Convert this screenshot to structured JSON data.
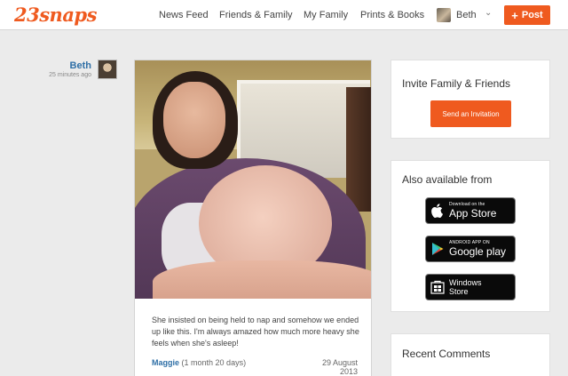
{
  "app": {
    "logo": "23snaps"
  },
  "nav": {
    "items": [
      "News Feed",
      "Friends & Family",
      "My Family",
      "Prints & Books"
    ],
    "user_name": "Beth",
    "post_button": "Post"
  },
  "post": {
    "author": "Beth",
    "time_ago": "25 minutes ago",
    "caption": "She insisted on being held to nap and somehow we ended up like this. I'm always amazed how much more heavy she feels when she's asleep!",
    "child_name": "Maggie",
    "child_age": "(1 month 20 days)",
    "date": "29 August 2013"
  },
  "sidebar": {
    "invite": {
      "title": "Invite Family & Friends",
      "button": "Send an Invitation"
    },
    "apps": {
      "title": "Also available from",
      "appstore": {
        "small": "Download on the",
        "big": "App Store"
      },
      "googleplay": {
        "small": "ANDROID APP ON",
        "big": "Google play"
      },
      "windows": {
        "line1": "Windows",
        "line2": "Store"
      }
    },
    "recent_comments": {
      "title": "Recent Comments"
    }
  },
  "colors": {
    "accent": "#ef5a1f",
    "link": "#2f6fa6",
    "background": "#ebebeb"
  },
  "icons": [
    "chevron-down-icon",
    "plus-icon",
    "apple-icon",
    "google-play-icon",
    "windows-icon"
  ]
}
